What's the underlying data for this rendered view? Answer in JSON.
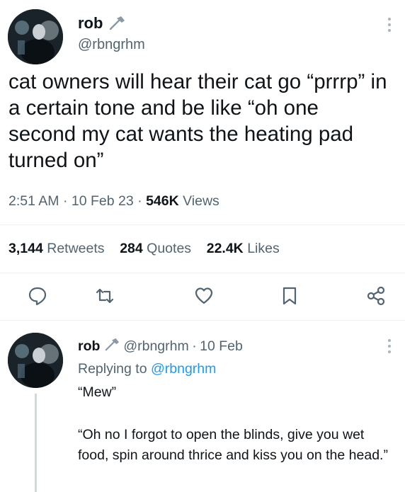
{
  "tweet": {
    "author_name": "rob",
    "author_handle": "@rbngrhm",
    "text": "cat owners will hear their cat go “prrrp” in a certain tone and be like “oh one second my cat wants the heating pad turned on”",
    "time": "2:51 AM",
    "date": "10 Feb 23",
    "views_count": "546K",
    "views_label": "Views",
    "retweets_count": "3,144",
    "retweets_label": "Retweets",
    "quotes_count": "284",
    "quotes_label": "Quotes",
    "likes_count": "22.4K",
    "likes_label": "Likes",
    "actions": [
      "reply-icon",
      "retweet-icon",
      "like-icon",
      "bookmark-icon",
      "share-icon"
    ]
  },
  "reply": {
    "author_name": "rob",
    "author_handle": "@rbngrhm",
    "date": "10 Feb",
    "replying_prefix": "Replying to",
    "replying_to": "@rbngrhm",
    "line1": "“Mew”",
    "line2": "“Oh no I forgot to open the blinds, give you wet food, spin around thrice and kiss you on the head.”"
  },
  "colors": {
    "accent": "#1d9bf0",
    "secondary_text": "#536471",
    "primary_text": "#0f1419"
  }
}
